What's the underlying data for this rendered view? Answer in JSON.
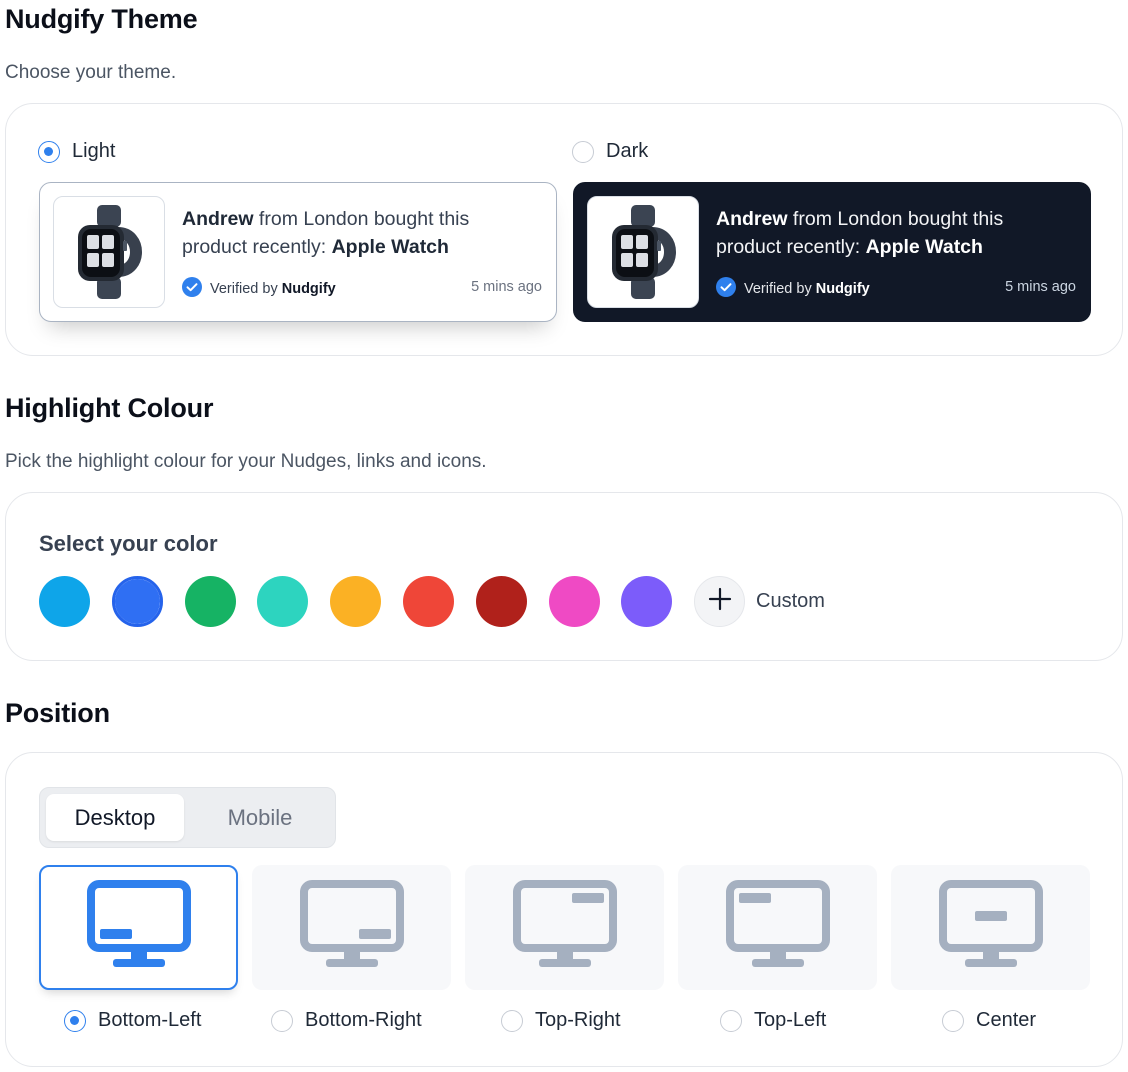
{
  "theme_section": {
    "title": "Nudgify Theme",
    "subtitle": "Choose your theme.",
    "options": [
      {
        "label": "Light",
        "selected": true
      },
      {
        "label": "Dark",
        "selected": false
      }
    ],
    "preview": {
      "name": "Andrew",
      "middle": " from London bought this product recently: ",
      "product": "Apple Watch",
      "verified_prefix": "Verified by ",
      "verified_brand": "Nudgify",
      "time": "5 mins ago",
      "image_icon": "apple-watch-image"
    }
  },
  "color_section": {
    "title": "Highlight Colour",
    "subtitle": "Pick the highlight colour for your Nudges, links and icons.",
    "select_label": "Select your color",
    "swatches": [
      "#0ea5e9",
      "#2f6ff3",
      "#16b364",
      "#2dd4bf",
      "#fbb124",
      "#ef4638",
      "#b0211b",
      "#ef4ac4",
      "#7c5cfa"
    ],
    "selected_index": 1,
    "custom_label": "Custom",
    "custom_icon": "plus-icon"
  },
  "position_section": {
    "title": "Position",
    "tabs": [
      {
        "label": "Desktop",
        "active": true
      },
      {
        "label": "Mobile",
        "active": false
      }
    ],
    "options": [
      {
        "label": "Bottom-Left",
        "selected": true
      },
      {
        "label": "Bottom-Right",
        "selected": false
      },
      {
        "label": "Top-Right",
        "selected": false
      },
      {
        "label": "Top-Left",
        "selected": false
      },
      {
        "label": "Center",
        "selected": false
      }
    ],
    "icon_color_active": "#2f80ed",
    "icon_color_inactive": "#a5b0c0"
  }
}
